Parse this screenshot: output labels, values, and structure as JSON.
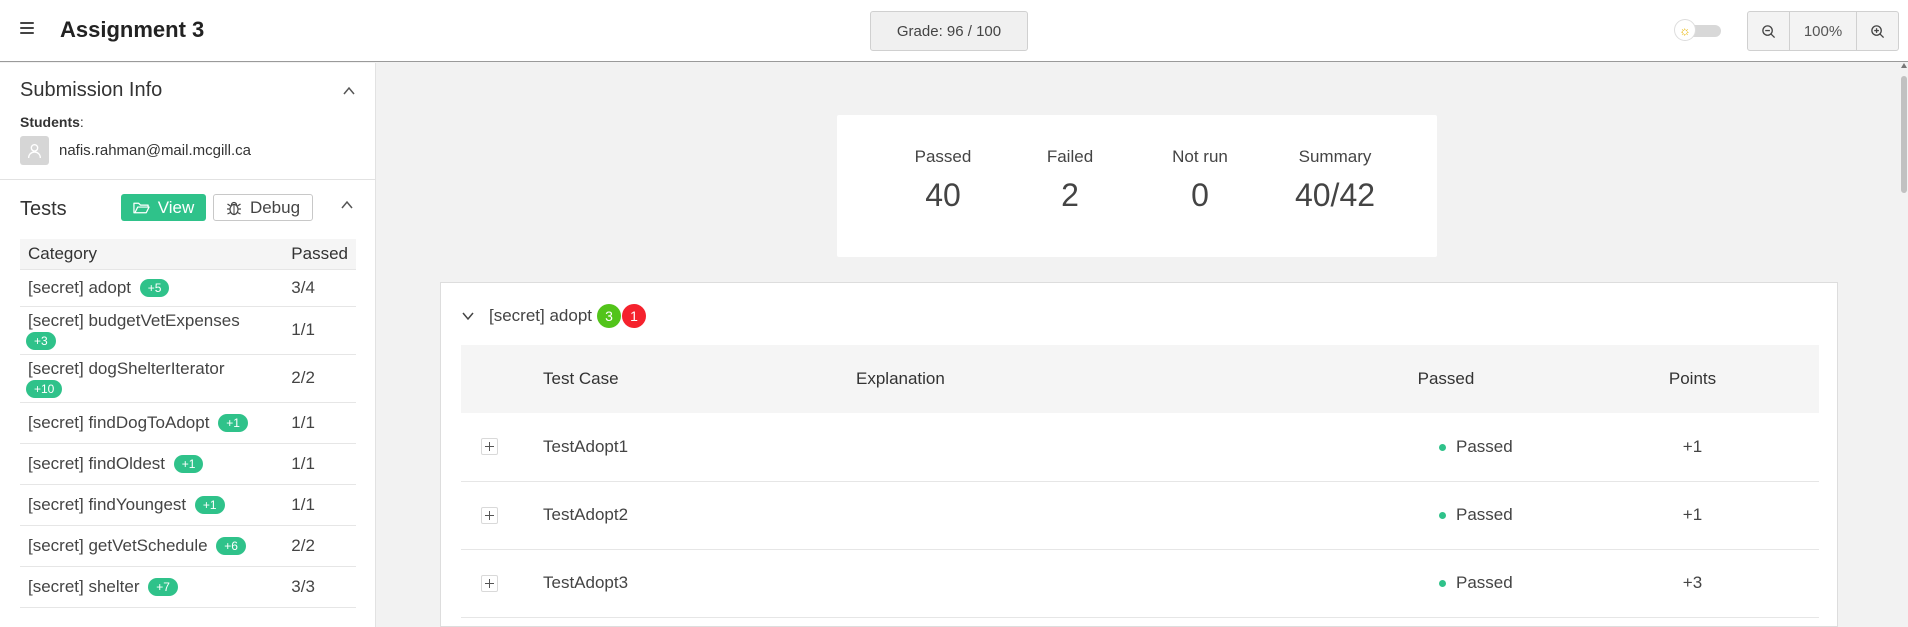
{
  "header": {
    "title": "Assignment 3",
    "grade": "Grade: 96 / 100",
    "zoom": "100%"
  },
  "submission": {
    "title": "Submission Info",
    "students_label": "Students",
    "student_email": "nafis.rahman@mail.mcgill.ca"
  },
  "tests": {
    "title": "Tests",
    "view_label": "View",
    "debug_label": "Debug",
    "col_category": "Category",
    "col_passed": "Passed",
    "rows": [
      {
        "category": "[secret] adopt",
        "badge": "+5",
        "passed": "3/4"
      },
      {
        "category": "[secret] budgetVetExpenses",
        "badge": "+3",
        "passed": "1/1"
      },
      {
        "category": "[secret] dogShelterIterator",
        "badge": "+10",
        "passed": "2/2"
      },
      {
        "category": "[secret] findDogToAdopt",
        "badge": "+1",
        "passed": "1/1"
      },
      {
        "category": "[secret] findOldest",
        "badge": "+1",
        "passed": "1/1"
      },
      {
        "category": "[secret] findYoungest",
        "badge": "+1",
        "passed": "1/1"
      },
      {
        "category": "[secret] getVetSchedule",
        "badge": "+6",
        "passed": "2/2"
      },
      {
        "category": "[secret] shelter",
        "badge": "+7",
        "passed": "3/3"
      }
    ]
  },
  "summary": {
    "passed_label": "Passed",
    "passed_value": "40",
    "failed_label": "Failed",
    "failed_value": "2",
    "notrun_label": "Not run",
    "notrun_value": "0",
    "summary_label": "Summary",
    "summary_value": "40/42"
  },
  "group": {
    "name": "[secret] adopt",
    "passed_count": "3",
    "failed_count": "1",
    "col_case": "Test Case",
    "col_explanation": "Explanation",
    "col_passed": "Passed",
    "col_points": "Points",
    "cases": [
      {
        "name": "TestAdopt1",
        "explanation": "",
        "status": "Passed",
        "points": "+1"
      },
      {
        "name": "TestAdopt2",
        "explanation": "",
        "status": "Passed",
        "points": "+1"
      },
      {
        "name": "TestAdopt3",
        "explanation": "",
        "status": "Passed",
        "points": "+3"
      }
    ]
  },
  "colors": {
    "accent": "#2fc28a",
    "pass_dot": "#52c41a",
    "fail_dot": "#f5222d"
  },
  "icons": {
    "menu": "hamburger-icon",
    "theme": "sun-icon",
    "zoom_out": "zoom-out-icon",
    "zoom_in": "zoom-in-icon",
    "collapse": "chevron-up-icon",
    "folder": "folder-open-icon",
    "bug": "bug-icon",
    "avatar": "user-icon",
    "expand": "plus-icon",
    "group_toggle": "chevron-down-icon"
  }
}
